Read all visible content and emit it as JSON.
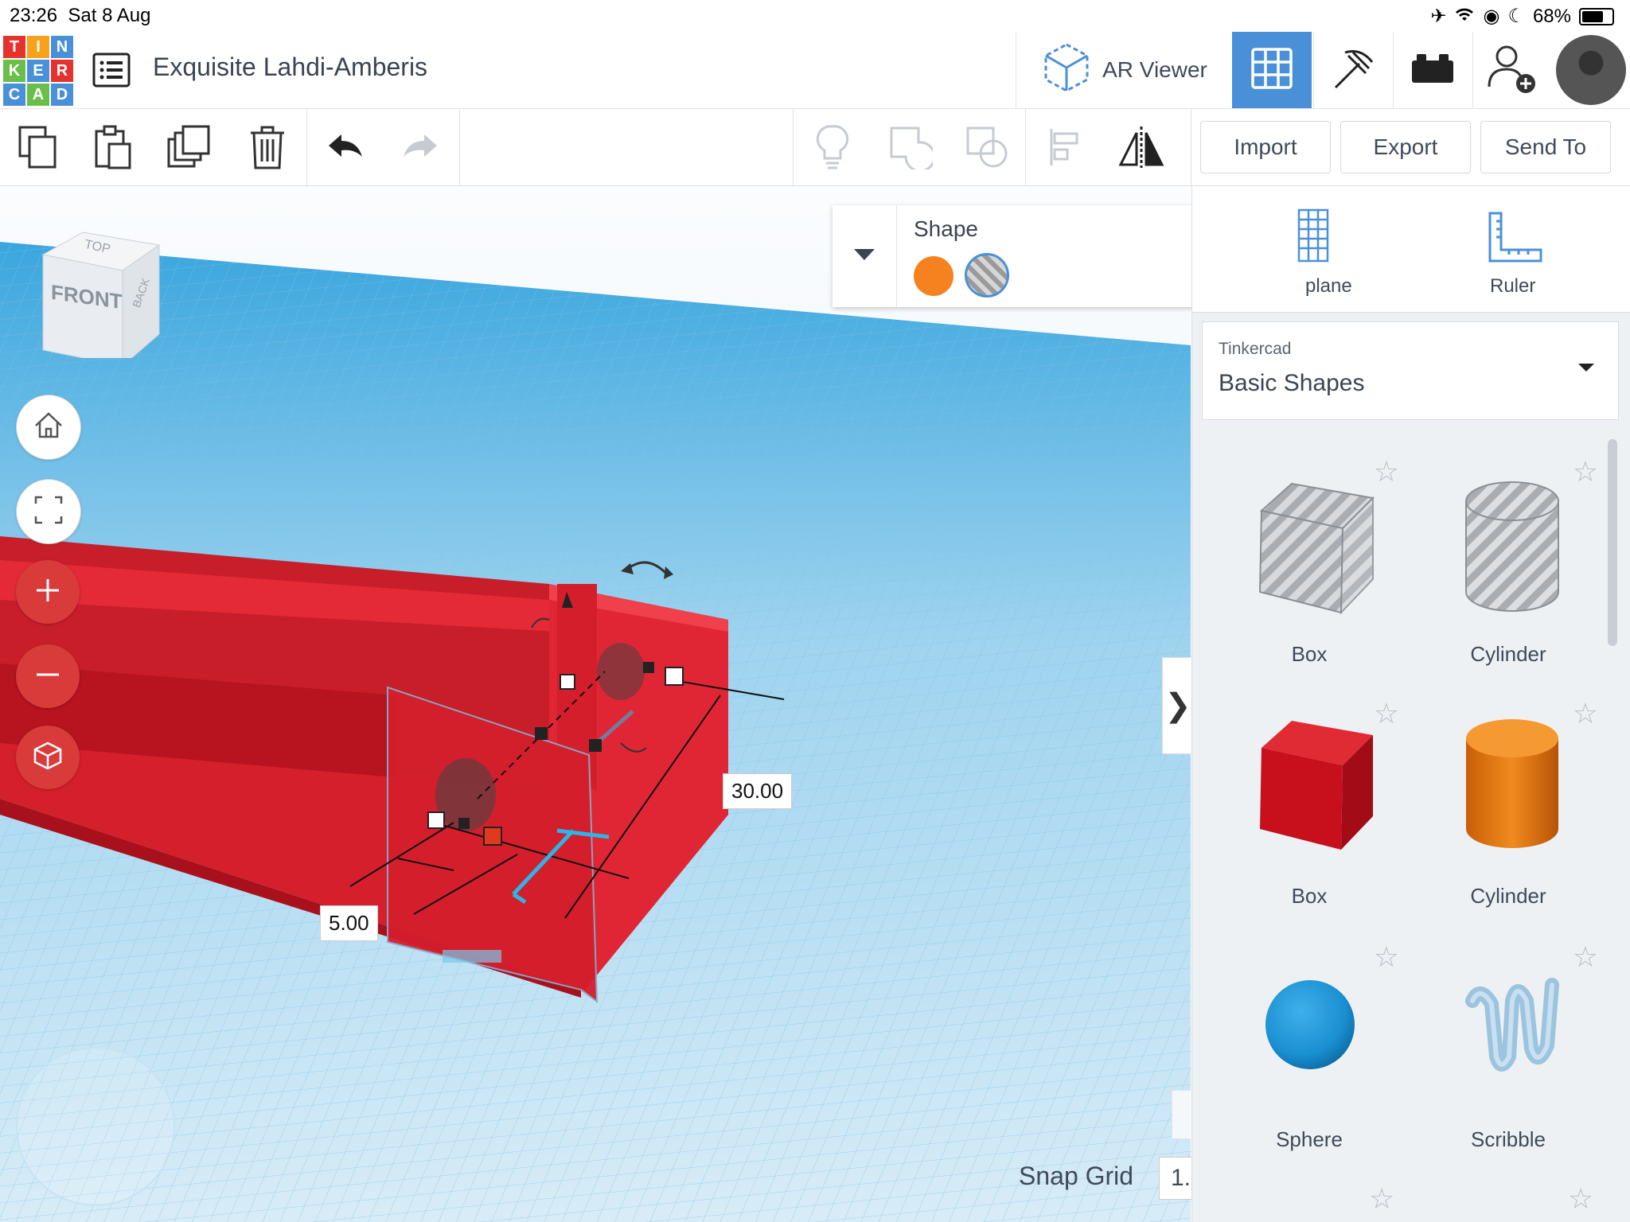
{
  "status_bar": {
    "time": "23:26",
    "date": "Sat 8 Aug",
    "battery": "68%"
  },
  "header": {
    "logo_letters": [
      "T",
      "I",
      "N",
      "K",
      "E",
      "R",
      "C",
      "A",
      "D"
    ],
    "title": "Exquisite Lahdi-Amberis",
    "ar_viewer_label": "AR Viewer"
  },
  "toolbar": {
    "import_label": "Import",
    "export_label": "Export",
    "send_to_label": "Send To"
  },
  "viewcube": {
    "front": "FRONT",
    "top": "TOP",
    "back": "BACK"
  },
  "workplane": {
    "dim_height": "30.00",
    "dim_width": "5.00"
  },
  "inspector": {
    "title": "Shape",
    "solid_color": "#f5821f"
  },
  "panel": {
    "workplane_label": "plane",
    "ruler_label": "Ruler",
    "library_source": "Tinkercad",
    "library_name": "Basic Shapes",
    "shapes": [
      {
        "label": "Box"
      },
      {
        "label": "Cylinder"
      },
      {
        "label": "Box"
      },
      {
        "label": "Cylinder"
      },
      {
        "label": "Sphere"
      },
      {
        "label": "Scribble"
      }
    ]
  },
  "snap_grid": {
    "label": "Snap Grid",
    "value": "1."
  },
  "colors": {
    "accent_blue": "#4a90d9",
    "object_red": "#d61f2d",
    "sphere_blue": "#1a8fd1",
    "cylinder_orange": "#e8730f"
  }
}
